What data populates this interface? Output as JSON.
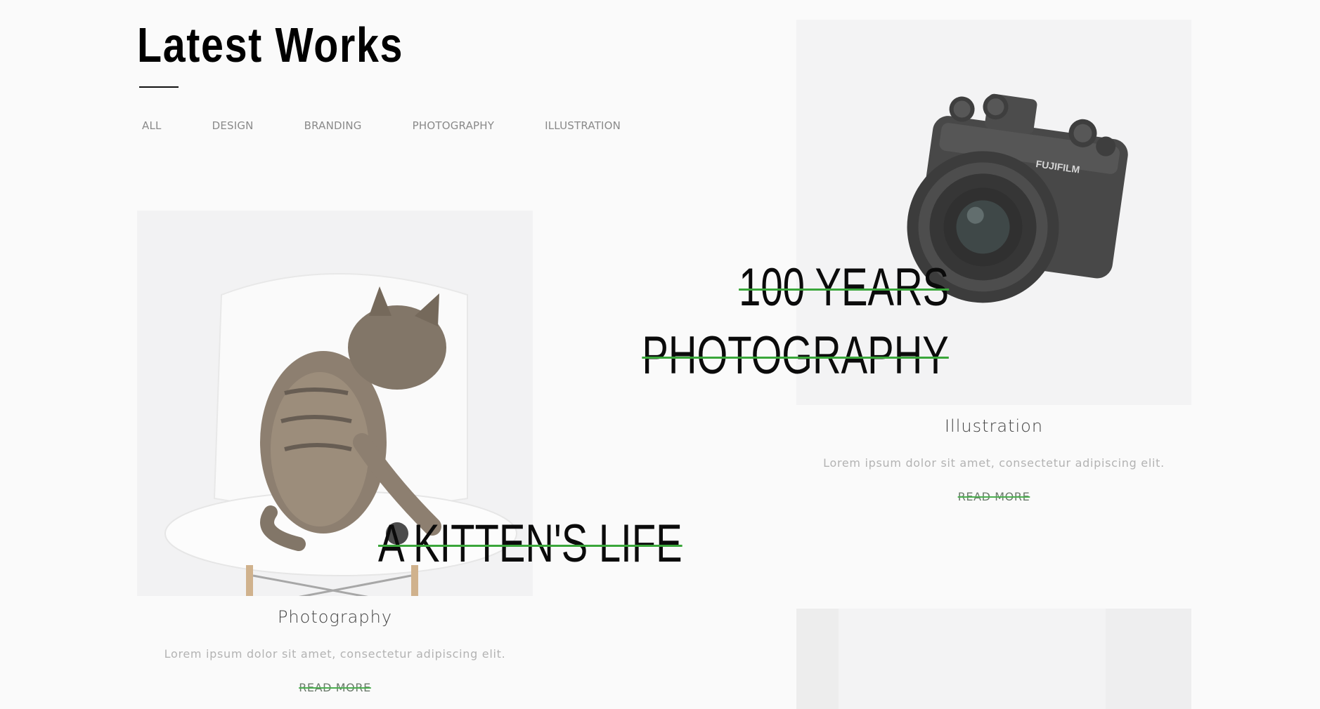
{
  "section": {
    "title": "Latest Works"
  },
  "filters": [
    {
      "label": "ALL"
    },
    {
      "label": "DESIGN"
    },
    {
      "label": "BRANDING"
    },
    {
      "label": "PHOTOGRAPHY"
    },
    {
      "label": "ILLUSTRATION"
    }
  ],
  "cards": {
    "camera": {
      "overlay_line1": "100 YEARS",
      "overlay_line2": "PHOTOGRAPHY",
      "category": "Illustration",
      "description": "Lorem ipsum dolor sit amet, consectetur adipiscing elit.",
      "link": "READ MORE"
    },
    "kitten": {
      "overlay": "A KITTEN'S LIFE",
      "category": "Photography",
      "description": "Lorem ipsum dolor sit amet, consectetur adipiscing elit.",
      "link": "READ MORE"
    }
  },
  "colors": {
    "background": "#fafafa",
    "accent_strike": "#3aa63a",
    "heading": "#000000",
    "muted_text": "#b3b3b3"
  }
}
